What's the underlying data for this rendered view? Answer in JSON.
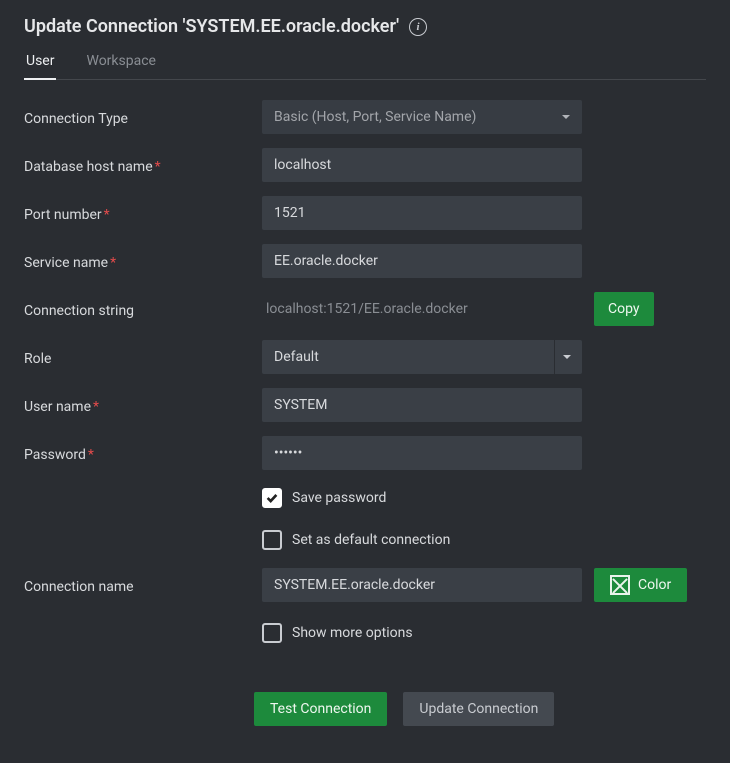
{
  "header": {
    "title": "Update Connection 'SYSTEM.EE.oracle.docker'"
  },
  "tabs": {
    "user": "User",
    "workspace": "Workspace"
  },
  "labels": {
    "connection_type": "Connection Type",
    "host": "Database host name",
    "port": "Port number",
    "service": "Service name",
    "conn_string": "Connection string",
    "role": "Role",
    "user": "User name",
    "password": "Password",
    "save_pw": "Save password",
    "default_conn": "Set as default connection",
    "conn_name": "Connection name",
    "show_more": "Show more options"
  },
  "values": {
    "connection_type": "Basic (Host, Port, Service Name)",
    "host": "localhost",
    "port": "1521",
    "service": "EE.oracle.docker",
    "conn_string": "localhost:1521/EE.oracle.docker",
    "role": "Default",
    "user": "SYSTEM",
    "password": "••••••",
    "save_pw_checked": true,
    "default_conn_checked": false,
    "conn_name": "SYSTEM.EE.oracle.docker",
    "show_more_checked": false
  },
  "buttons": {
    "copy": "Copy",
    "color": "Color",
    "test": "Test Connection",
    "update": "Update Connection"
  },
  "colors": {
    "accent": "#1d8a3c"
  }
}
